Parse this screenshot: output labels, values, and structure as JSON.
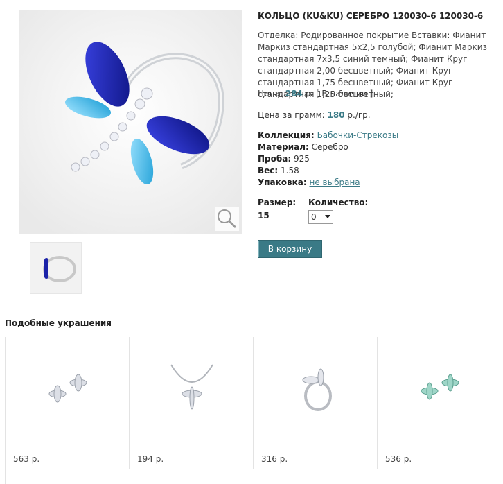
{
  "product": {
    "title": "КОЛЬЦО (KU&KU) СЕРЕБРО 120030-6 120030-6",
    "description": "Отделка: Родированное покрытие Вставки: Фианит Маркиз стандартная 5х2,5 голубой; Фианит Маркиз стандартная 7х3,5 синий темный; Фианит Круг стандартная 2,00 бесцветный; Фианит Круг стандартная 1,75 бесцветный; Фианит Круг стандартная 1,25 бесцветный;",
    "price_label": "Цена:",
    "price_value": "284",
    "price_unit": "р.",
    "availability": "[ В наличии ]",
    "ppg_label": "Цена за грамм:",
    "ppg_value": "180",
    "ppg_unit": "р./гр.",
    "collection_label": "Коллекция:",
    "collection_value": "Бабочки-Стрекозы",
    "material_label": "Материал:",
    "material_value": "Серебро",
    "probe_label": "Проба:",
    "probe_value": "925",
    "weight_label": "Вес:",
    "weight_value": "1.58",
    "package_label": "Упаковка:",
    "package_value": "не выбрана",
    "size_label": "Размер:",
    "size_value": "15",
    "qty_label": "Количество:",
    "qty_value": "0",
    "cart_button": "В корзину"
  },
  "similar": {
    "title": "Подобные украшения",
    "items": [
      {
        "price": "563 р."
      },
      {
        "price": "194 р."
      },
      {
        "price": "316 р."
      },
      {
        "price": "536 р."
      }
    ]
  },
  "colors": {
    "accent": "#3a7a86",
    "dark_stone": "#1b22a8",
    "light_stone": "#3fb4e0"
  }
}
